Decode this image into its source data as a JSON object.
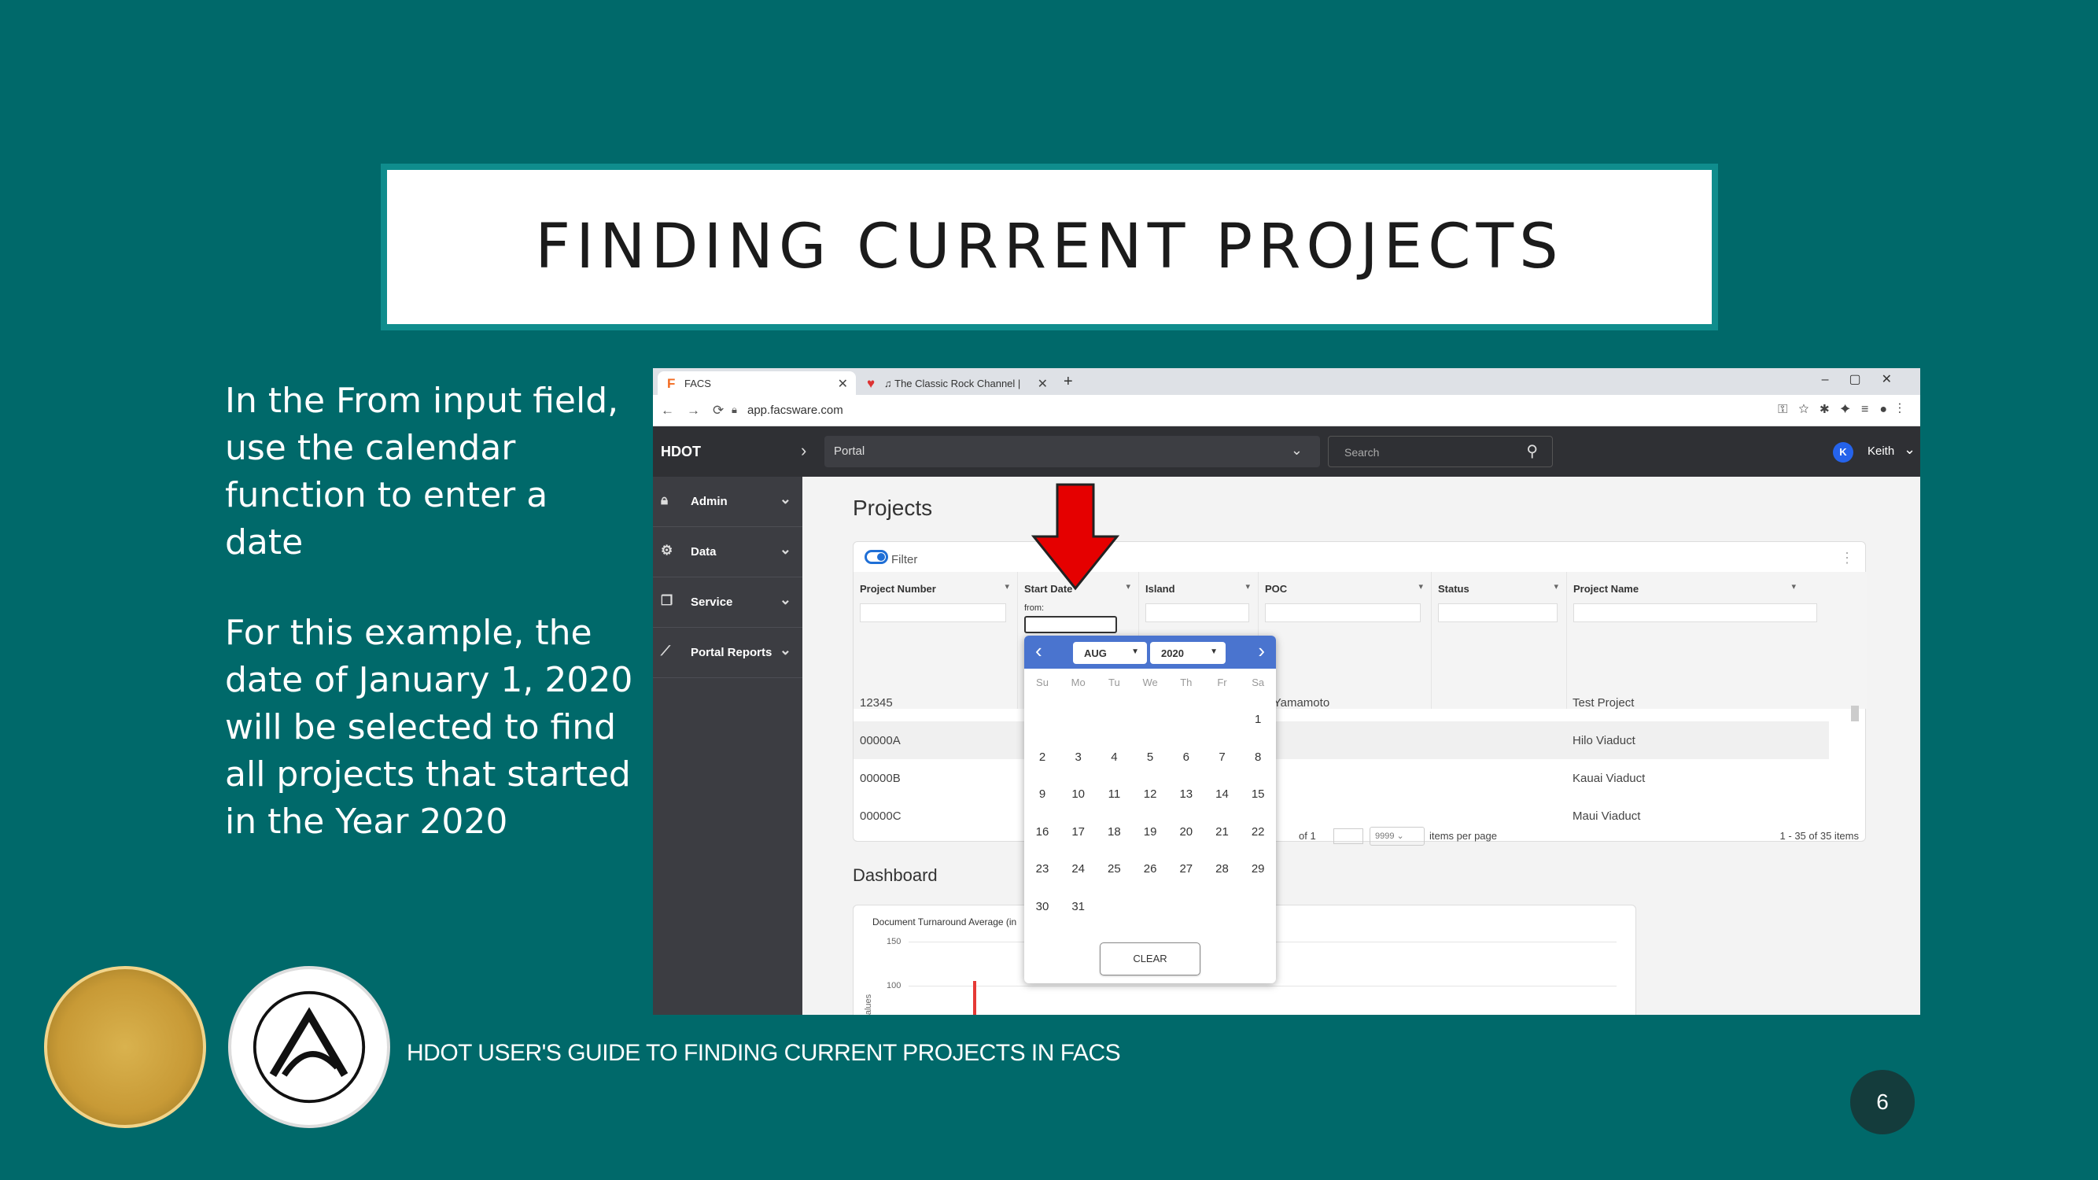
{
  "slide": {
    "title": "FINDING CURRENT PROJECTS",
    "para1": "In the From input field, use the calendar function to enter a date",
    "para2": "For this example, the date of January 1, 2020 will be selected to find all projects that started in the Year 2020",
    "footer": "HDOT USER'S GUIDE TO FINDING CURRENT PROJECTS IN FACS",
    "page_number": "6"
  },
  "browser": {
    "tab1": "FACS",
    "tab2": "♫ The Classic Rock Channel |",
    "url": "app.facsware.com"
  },
  "app": {
    "brand": "HDOT",
    "portal": "Portal",
    "search_placeholder": "Search",
    "user_initial": "K",
    "user_name": "Keith",
    "sidebar": [
      "Admin",
      "Data",
      "Service",
      "Portal Reports"
    ],
    "projects_heading": "Projects",
    "filter_label": "Filter",
    "columns": [
      "Project Number",
      "Start Date",
      "Island",
      "POC",
      "Status",
      "Project Name"
    ],
    "from_label": "from:",
    "rows": [
      {
        "number": "12345",
        "poc": "ith Yamamoto",
        "name": "Test Project"
      },
      {
        "number": "00000A",
        "poc": "",
        "name": "Hilo Viaduct"
      },
      {
        "number": "00000B",
        "poc": "",
        "name": "Kauai Viaduct"
      },
      {
        "number": "00000C",
        "poc": "",
        "name": "Maui Viaduct"
      }
    ],
    "pager_of": "of 1",
    "pager_size": "9999",
    "pager_items": "items per page",
    "pager_range": "1 - 35 of 35 items",
    "dashboard_heading": "Dashboard",
    "dashboard_chart_title": "Document Turnaround Average (in",
    "dashboard_yticks": [
      "150",
      "100"
    ],
    "dashboard_ylabel": "alues"
  },
  "calendar": {
    "month": "AUG",
    "year": "2020",
    "weekdays": [
      "Su",
      "Mo",
      "Tu",
      "We",
      "Th",
      "Fr",
      "Sa"
    ],
    "first_weekday_index": 6,
    "days_in_month": 31,
    "selected_day": 25,
    "clear_label": "CLEAR"
  }
}
